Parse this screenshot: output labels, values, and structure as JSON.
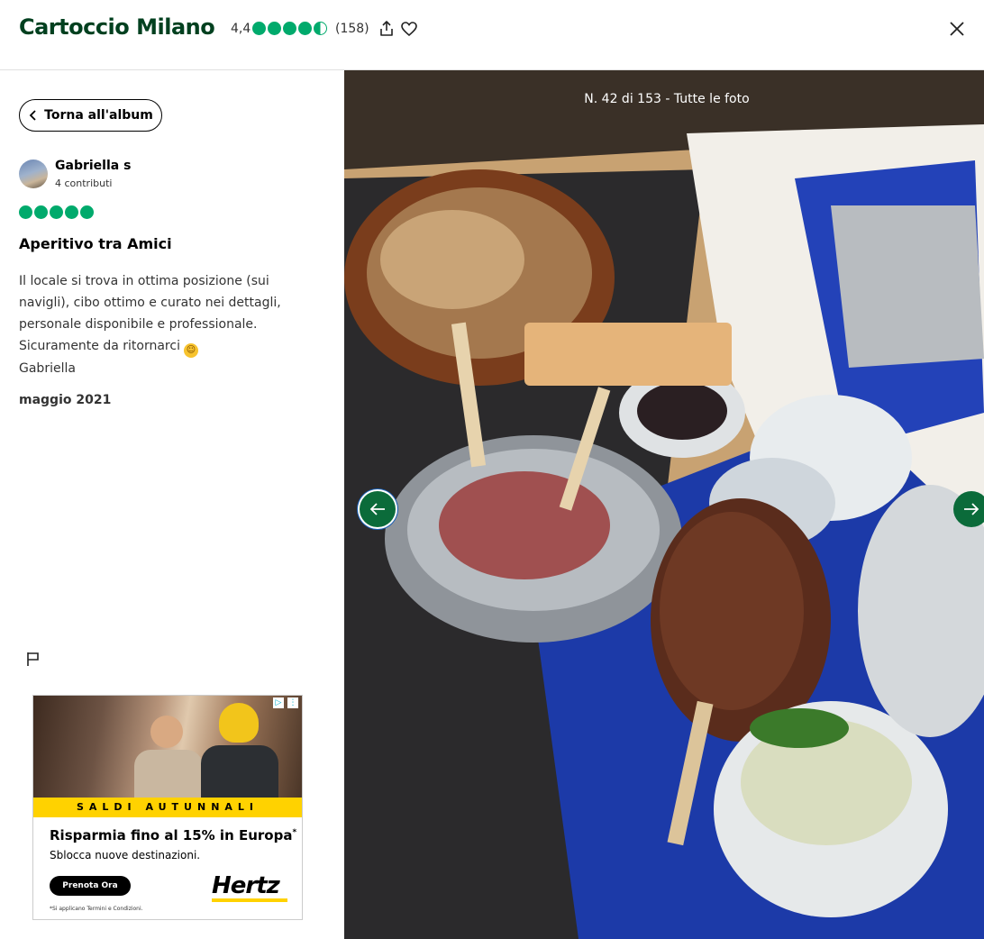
{
  "header": {
    "title": "Cartoccio Milano",
    "rating": "4,4",
    "rating_value": 4.5,
    "review_count": "(158)"
  },
  "left": {
    "back_label": "Torna all'album",
    "user": {
      "name": "Gabriella s",
      "contributions": "4 contributi"
    },
    "review_rating": 5,
    "review_title": "Aperitivo tra Amici",
    "review_lines": [
      "Il locale si trova in ottima posizione (sui",
      "navigli), cibo ottimo e curato nei dettagli,",
      "personale disponibile e professionale.",
      "Sicuramente da ritornarci",
      "Gabriella"
    ],
    "review_date": "maggio 2021"
  },
  "ad": {
    "band": "SALDI AUTUNNALI",
    "headline": "Risparmia fino al 15% in Europa",
    "headline_mark": "*",
    "sub": "Sblocca nuove destinazioni.",
    "cta": "Prenota Ora",
    "logo": "Hertz",
    "disclaimer": "*Si applicano Termini e Condizioni."
  },
  "photo": {
    "counter": "N. 42 di 153 - Tutte le foto"
  },
  "colors": {
    "brand": "#00aa6c",
    "title": "#00401f",
    "nav_button": "#0b6b3a",
    "ad_yellow": "#ffd200"
  },
  "icons": [
    "share-icon",
    "heart-icon",
    "close-icon",
    "chevron-left-icon",
    "flag-icon",
    "arrow-left-icon",
    "arrow-right-icon",
    "ad-choices-icon"
  ]
}
